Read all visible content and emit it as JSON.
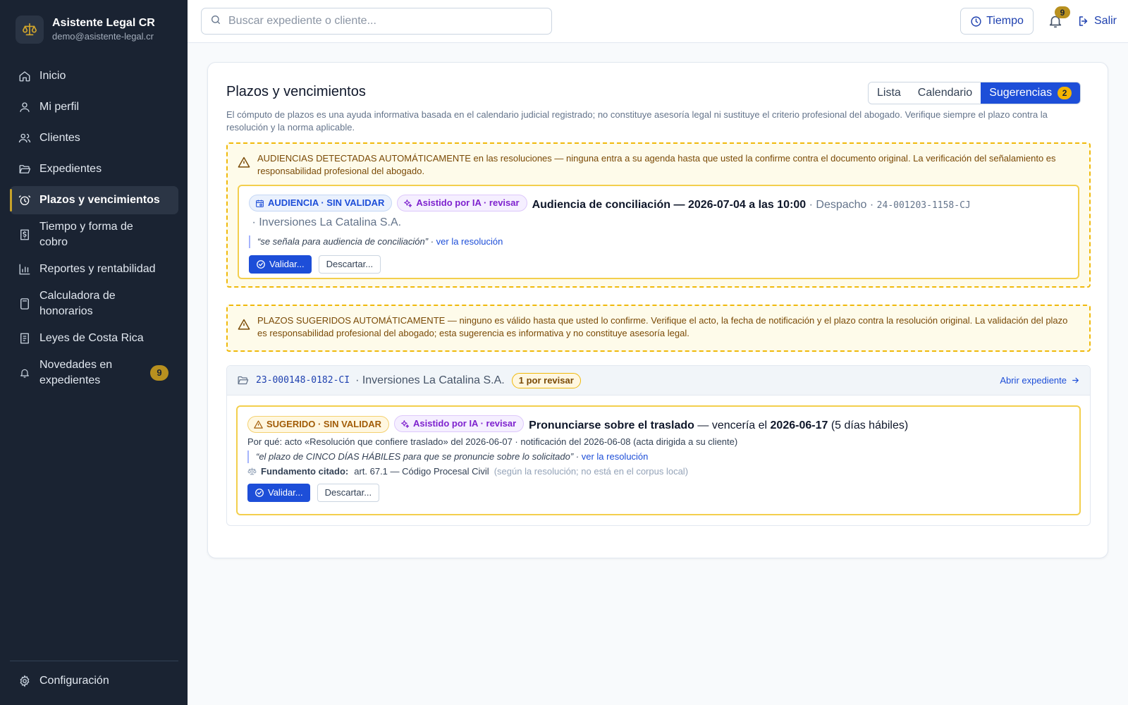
{
  "app": {
    "name": "Asistente Legal CR",
    "email": "demo@asistente-legal.cr"
  },
  "sidebar": {
    "items": [
      {
        "label": "Inicio",
        "icon": "home-icon"
      },
      {
        "label": "Mi perfil",
        "icon": "user-icon"
      },
      {
        "label": "Clientes",
        "icon": "users-icon"
      },
      {
        "label": "Expedientes",
        "icon": "folder-open-icon"
      },
      {
        "label": "Plazos y vencimientos",
        "icon": "alarm-clock-icon",
        "active": true
      },
      {
        "label": "Tiempo y forma de cobro",
        "icon": "receipt-icon"
      },
      {
        "label": "Reportes y rentabilidad",
        "icon": "bar-chart-icon"
      },
      {
        "label": "Calculadora de honorarios",
        "icon": "calculator-icon"
      },
      {
        "label": "Leyes de Costa Rica",
        "icon": "book-icon"
      },
      {
        "label": "Novedades en expedientes",
        "icon": "bell-icon",
        "badge": "9"
      }
    ],
    "footer": {
      "label": "Configuración",
      "icon": "gear-icon"
    }
  },
  "header": {
    "search_placeholder": "Buscar expediente o cliente...",
    "time_label": "Tiempo",
    "notifications_count": "9",
    "exit_label": "Salir"
  },
  "page": {
    "title": "Plazos y vencimientos",
    "tabs": [
      {
        "label": "Lista"
      },
      {
        "label": "Calendario"
      },
      {
        "label": "Sugerencias",
        "count": "2",
        "active": true
      }
    ],
    "disclaimer": "El cómputo de plazos es una ayuda informativa basada en el calendario judicial registrado; no constituye asesoría legal ni sustituye el criterio profesional del abogado. Verifique siempre el plazo contra la resolución y la norma aplicable."
  },
  "hearings": {
    "warning": "AUDIENCIAS DETECTADAS AUTOMÁTICAMENTE en las resoluciones — ninguna entra a su agenda hasta que usted la confirme contra el documento original. La verificación del señalamiento es responsabilidad profesional del abogado.",
    "item": {
      "status_chip": "AUDIENCIA · SIN VALIDAR",
      "ai_chip": "Asistido por IA · revisar",
      "title": "Audiencia de conciliación — 2026-07-04 a las 10:00",
      "office_sep": " · Despacho · ",
      "case_number": "24-001203-1158-CJ",
      "client": " · Inversiones La Catalina S.A.",
      "quote": "“se señala para audiencia de conciliación”",
      "quote_sep": " · ",
      "link": "ver la resolución",
      "validate": "Validar...",
      "discard": "Descartar..."
    }
  },
  "deadlines": {
    "warning": "PLAZOS SUGERIDOS AUTOMÁTICAMENTE — ninguno es válido hasta que usted lo confirme. Verifique el acto, la fecha de notificación y el plazo contra la resolución original. La validación del plazo es responsabilidad profesional del abogado; esta sugerencia es informativa y no constituye asesoría legal.",
    "group": {
      "case_number": "23-000148-0182-CI",
      "client": "· Inversiones La Catalina S.A.",
      "review_pill": "1 por revisar",
      "open_link": "Abrir expediente"
    },
    "item": {
      "status_chip": "SUGERIDO · SIN VALIDAR",
      "ai_chip": "Asistido por IA · revisar",
      "title": "Pronunciarse sobre el traslado",
      "due_prefix": " — vencería el ",
      "due_date": "2026-06-17",
      "due_suffix": " (5 días hábiles)",
      "reason": "Por qué: acto «Resolución que confiere traslado» del 2026-06-07 · notificación del 2026-06-08 (acta dirigida a su cliente)",
      "quote": "“el plazo de CINCO DÍAS HÁBILES para que se pronuncie sobre lo solicitado”",
      "quote_sep": " · ",
      "link": "ver la resolución",
      "basis_label": "Fundamento citado:",
      "basis_value": "art. 67.1 — Código Procesal Civil",
      "basis_note": "(según la resolución; no está en el corpus local)",
      "validate": "Validar...",
      "discard": "Descartar..."
    }
  },
  "colors": {
    "sidebar_bg": "#1a2332",
    "primary": "#1d4ed8",
    "warning_border": "#f0b90b",
    "badge": "#b8901f"
  }
}
